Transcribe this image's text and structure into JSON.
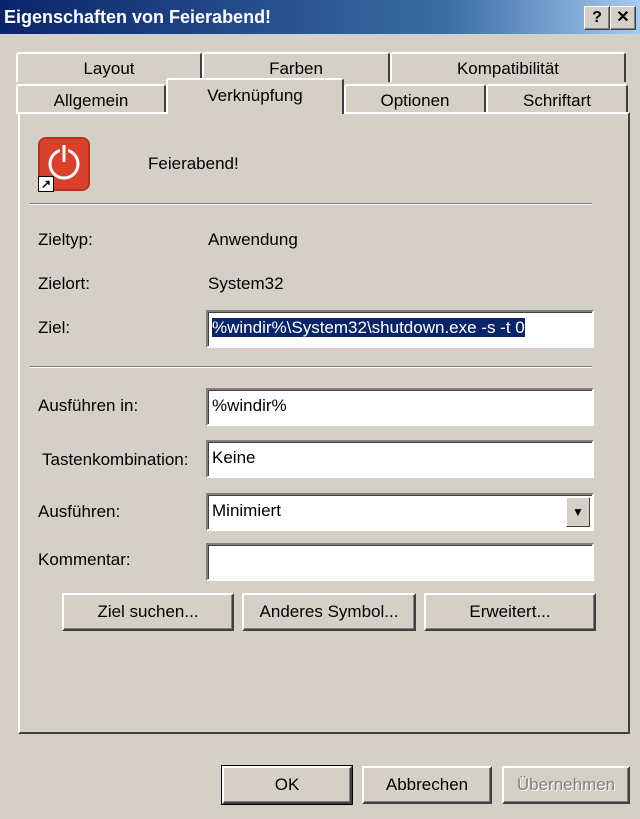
{
  "window": {
    "title": "Eigenschaften von Feierabend!",
    "help_label": "?",
    "close_label": "✕"
  },
  "tabs_row1": [
    {
      "label": "Layout"
    },
    {
      "label": "Farben"
    },
    {
      "label": "Kompatibilität"
    }
  ],
  "tabs_row2": [
    {
      "label": "Allgemein"
    },
    {
      "label": "Verknüpfung"
    },
    {
      "label": "Optionen"
    },
    {
      "label": "Schriftart"
    }
  ],
  "active_tab": "Verknüpfung",
  "shortcut": {
    "icon": "power-button-icon",
    "name": "Feierabend!",
    "target_type_label": "Zieltyp:",
    "target_type": "Anwendung",
    "target_location_label": "Zielort:",
    "target_location": "System32",
    "target_label": "Ziel:",
    "target_value": "%windir%\\System32\\shutdown.exe -s -t 0",
    "start_in_label": "Ausführen in:",
    "start_in_value": "%windir%",
    "hotkey_label": "Tastenkombination:",
    "hotkey_value": "Keine",
    "run_label": "Ausführen:",
    "run_value": "Minimiert",
    "comment_label": "Kommentar:",
    "comment_value": ""
  },
  "actions": {
    "find_target": "Ziel suchen...",
    "change_icon": "Anderes Symbol...",
    "advanced": "Erweitert..."
  },
  "footer": {
    "ok": "OK",
    "cancel": "Abbrechen",
    "apply": "Übernehmen"
  },
  "colors": {
    "titlebar_start": "#0a246a",
    "titlebar_end": "#a6caf0",
    "face": "#d4d0c8",
    "selection": "#0a246a",
    "icon_red": "#d9412a"
  }
}
